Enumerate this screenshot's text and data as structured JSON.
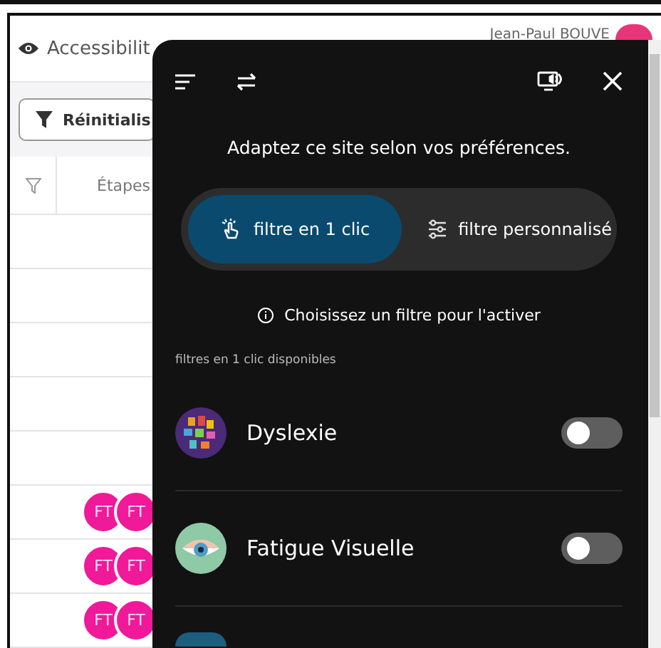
{
  "page": {
    "header": {
      "title": "Accessibilit",
      "user_name": "Jean-Paul BOUVE"
    },
    "toolbar": {
      "reset_button": "Réinitialis"
    },
    "table": {
      "columns": [
        "Étapes"
      ],
      "rows": [
        {
          "assignees": []
        },
        {
          "assignees": []
        },
        {
          "assignees": []
        },
        {
          "assignees": []
        },
        {
          "assignees": []
        },
        {
          "assignees": [
            "FT",
            "FT"
          ]
        },
        {
          "assignees": [
            "FT",
            "FT"
          ]
        },
        {
          "assignees": [
            "FT",
            "FT"
          ]
        }
      ]
    }
  },
  "panel": {
    "title": "Adaptez ce site selon vos préférences.",
    "modes": [
      {
        "label": "filtre en 1 clic",
        "kind": "one-click",
        "selected": true
      },
      {
        "label": "filtre personnalisé",
        "kind": "custom",
        "selected": false
      }
    ],
    "hint": "Choisissez un filtre pour l'activer",
    "section_label": "filtres en 1 clic disponibles",
    "filters": [
      {
        "name": "Dyslexie",
        "kind": "dyslexia",
        "on": false
      },
      {
        "name": "Fatigue Visuelle",
        "kind": "eye",
        "on": false
      }
    ]
  }
}
